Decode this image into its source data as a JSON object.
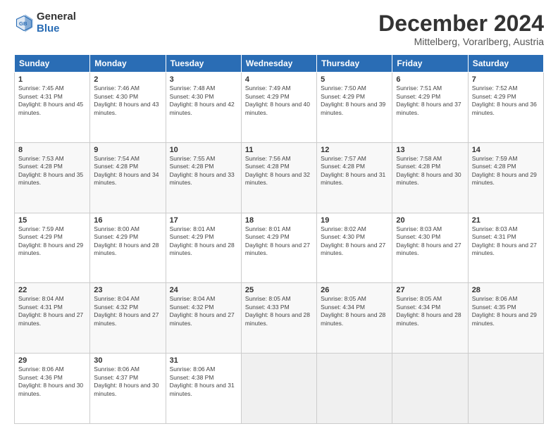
{
  "header": {
    "logo_general": "General",
    "logo_blue": "Blue",
    "month_title": "December 2024",
    "subtitle": "Mittelberg, Vorarlberg, Austria"
  },
  "calendar": {
    "days_of_week": [
      "Sunday",
      "Monday",
      "Tuesday",
      "Wednesday",
      "Thursday",
      "Friday",
      "Saturday"
    ],
    "weeks": [
      [
        null,
        {
          "day": "2",
          "sunrise": "Sunrise: 7:46 AM",
          "sunset": "Sunset: 4:30 PM",
          "daylight": "Daylight: 8 hours and 43 minutes."
        },
        {
          "day": "3",
          "sunrise": "Sunrise: 7:48 AM",
          "sunset": "Sunset: 4:30 PM",
          "daylight": "Daylight: 8 hours and 42 minutes."
        },
        {
          "day": "4",
          "sunrise": "Sunrise: 7:49 AM",
          "sunset": "Sunset: 4:29 PM",
          "daylight": "Daylight: 8 hours and 40 minutes."
        },
        {
          "day": "5",
          "sunrise": "Sunrise: 7:50 AM",
          "sunset": "Sunset: 4:29 PM",
          "daylight": "Daylight: 8 hours and 39 minutes."
        },
        {
          "day": "6",
          "sunrise": "Sunrise: 7:51 AM",
          "sunset": "Sunset: 4:29 PM",
          "daylight": "Daylight: 8 hours and 37 minutes."
        },
        {
          "day": "7",
          "sunrise": "Sunrise: 7:52 AM",
          "sunset": "Sunset: 4:29 PM",
          "daylight": "Daylight: 8 hours and 36 minutes."
        }
      ],
      [
        {
          "day": "1",
          "sunrise": "Sunrise: 7:45 AM",
          "sunset": "Sunset: 4:31 PM",
          "daylight": "Daylight: 8 hours and 45 minutes."
        },
        {
          "day": "9",
          "sunrise": "Sunrise: 7:54 AM",
          "sunset": "Sunset: 4:28 PM",
          "daylight": "Daylight: 8 hours and 34 minutes."
        },
        {
          "day": "10",
          "sunrise": "Sunrise: 7:55 AM",
          "sunset": "Sunset: 4:28 PM",
          "daylight": "Daylight: 8 hours and 33 minutes."
        },
        {
          "day": "11",
          "sunrise": "Sunrise: 7:56 AM",
          "sunset": "Sunset: 4:28 PM",
          "daylight": "Daylight: 8 hours and 32 minutes."
        },
        {
          "day": "12",
          "sunrise": "Sunrise: 7:57 AM",
          "sunset": "Sunset: 4:28 PM",
          "daylight": "Daylight: 8 hours and 31 minutes."
        },
        {
          "day": "13",
          "sunrise": "Sunrise: 7:58 AM",
          "sunset": "Sunset: 4:28 PM",
          "daylight": "Daylight: 8 hours and 30 minutes."
        },
        {
          "day": "14",
          "sunrise": "Sunrise: 7:59 AM",
          "sunset": "Sunset: 4:28 PM",
          "daylight": "Daylight: 8 hours and 29 minutes."
        }
      ],
      [
        {
          "day": "8",
          "sunrise": "Sunrise: 7:53 AM",
          "sunset": "Sunset: 4:28 PM",
          "daylight": "Daylight: 8 hours and 35 minutes."
        },
        {
          "day": "16",
          "sunrise": "Sunrise: 8:00 AM",
          "sunset": "Sunset: 4:29 PM",
          "daylight": "Daylight: 8 hours and 28 minutes."
        },
        {
          "day": "17",
          "sunrise": "Sunrise: 8:01 AM",
          "sunset": "Sunset: 4:29 PM",
          "daylight": "Daylight: 8 hours and 28 minutes."
        },
        {
          "day": "18",
          "sunrise": "Sunrise: 8:01 AM",
          "sunset": "Sunset: 4:29 PM",
          "daylight": "Daylight: 8 hours and 27 minutes."
        },
        {
          "day": "19",
          "sunrise": "Sunrise: 8:02 AM",
          "sunset": "Sunset: 4:30 PM",
          "daylight": "Daylight: 8 hours and 27 minutes."
        },
        {
          "day": "20",
          "sunrise": "Sunrise: 8:03 AM",
          "sunset": "Sunset: 4:30 PM",
          "daylight": "Daylight: 8 hours and 27 minutes."
        },
        {
          "day": "21",
          "sunrise": "Sunrise: 8:03 AM",
          "sunset": "Sunset: 4:31 PM",
          "daylight": "Daylight: 8 hours and 27 minutes."
        }
      ],
      [
        {
          "day": "15",
          "sunrise": "Sunrise: 7:59 AM",
          "sunset": "Sunset: 4:29 PM",
          "daylight": "Daylight: 8 hours and 29 minutes."
        },
        {
          "day": "23",
          "sunrise": "Sunrise: 8:04 AM",
          "sunset": "Sunset: 4:32 PM",
          "daylight": "Daylight: 8 hours and 27 minutes."
        },
        {
          "day": "24",
          "sunrise": "Sunrise: 8:04 AM",
          "sunset": "Sunset: 4:32 PM",
          "daylight": "Daylight: 8 hours and 27 minutes."
        },
        {
          "day": "25",
          "sunrise": "Sunrise: 8:05 AM",
          "sunset": "Sunset: 4:33 PM",
          "daylight": "Daylight: 8 hours and 28 minutes."
        },
        {
          "day": "26",
          "sunrise": "Sunrise: 8:05 AM",
          "sunset": "Sunset: 4:34 PM",
          "daylight": "Daylight: 8 hours and 28 minutes."
        },
        {
          "day": "27",
          "sunrise": "Sunrise: 8:05 AM",
          "sunset": "Sunset: 4:34 PM",
          "daylight": "Daylight: 8 hours and 28 minutes."
        },
        {
          "day": "28",
          "sunrise": "Sunrise: 8:06 AM",
          "sunset": "Sunset: 4:35 PM",
          "daylight": "Daylight: 8 hours and 29 minutes."
        }
      ],
      [
        {
          "day": "22",
          "sunrise": "Sunrise: 8:04 AM",
          "sunset": "Sunset: 4:31 PM",
          "daylight": "Daylight: 8 hours and 27 minutes."
        },
        {
          "day": "30",
          "sunrise": "Sunrise: 8:06 AM",
          "sunset": "Sunset: 4:37 PM",
          "daylight": "Daylight: 8 hours and 30 minutes."
        },
        {
          "day": "31",
          "sunrise": "Sunrise: 8:06 AM",
          "sunset": "Sunset: 4:38 PM",
          "daylight": "Daylight: 8 hours and 31 minutes."
        },
        null,
        null,
        null,
        null
      ],
      [
        {
          "day": "29",
          "sunrise": "Sunrise: 8:06 AM",
          "sunset": "Sunset: 4:36 PM",
          "daylight": "Daylight: 8 hours and 30 minutes."
        },
        null,
        null,
        null,
        null,
        null,
        null
      ]
    ]
  }
}
